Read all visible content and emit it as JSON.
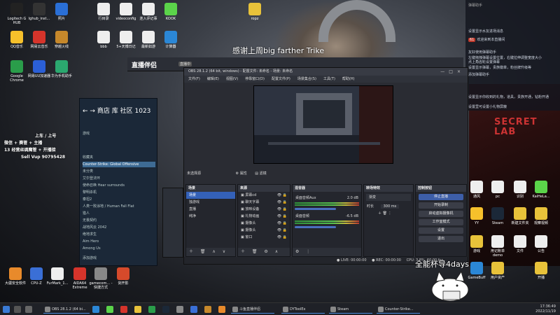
{
  "desktop": {
    "icons": [
      {
        "label": "Logitech G HUB",
        "color": "#222"
      },
      {
        "label": "lghub_inst...",
        "color": "#333"
      },
      {
        "label": "照片",
        "color": "#2a6fd6"
      },
      {
        "label": "QQ音乐",
        "color": "#f6c02b"
      },
      {
        "label": "网易云音乐",
        "color": "#d6342b"
      },
      {
        "label": "穿越火线",
        "color": "#c6882b"
      },
      {
        "label": "Google Chrome",
        "color": "#2a9d4a"
      },
      {
        "label": "网易UU加速器",
        "color": "#2b5fd6"
      },
      {
        "label": "华为手机助手",
        "color": "#2ba86f"
      },
      {
        "label": "行目录",
        "color": "#eee"
      },
      {
        "label": "videoconfig",
        "color": "#eee"
      },
      {
        "label": "连入评记事",
        "color": "#eee"
      },
      {
        "label": "KOOK",
        "color": "#5bd44a"
      },
      {
        "label": "bbb",
        "color": "#eee"
      },
      {
        "label": "5+天博日记",
        "color": "#eee"
      },
      {
        "label": "最新如游",
        "color": "#eee"
      },
      {
        "label": "计算器",
        "color": "#2b87d6"
      },
      {
        "label": "ropz",
        "color": "#e8c23a"
      }
    ],
    "bottom_icons": [
      {
        "label": "大疆安全软件",
        "color": "#e88a2b"
      },
      {
        "label": "CPU-Z",
        "color": "#3a6fd6"
      },
      {
        "label": "FurMark_1...",
        "color": "#eee"
      },
      {
        "label": "AIDA64 Extreme",
        "color": "#d6342b"
      },
      {
        "label": "gamecom... - 快捷方式",
        "color": "#888"
      },
      {
        "label": "剑开影",
        "color": "#d64a2b"
      }
    ],
    "right_icons": [
      {
        "label": "通风",
        "color": "#eee"
      },
      {
        "label": "pc",
        "color": "#eee"
      },
      {
        "label": "识别",
        "color": "#eee"
      },
      {
        "label": "KaiHeLa...",
        "color": "#5bd44a"
      },
      {
        "label": "YY",
        "color": "#f6c02b"
      },
      {
        "label": "Steam",
        "color": "#1b2838"
      },
      {
        "label": "新建文件夹",
        "color": "#e8c23a"
      },
      {
        "label": "观察视频",
        "color": "#e8c23a"
      },
      {
        "label": "游戏",
        "color": "#e8c23a"
      },
      {
        "label": "用记账单 demo",
        "color": "#eee"
      },
      {
        "label": "文件",
        "color": "#eee"
      },
      {
        "label": "公告",
        "color": "#eee"
      },
      {
        "label": "GameBuff",
        "color": "#2b87d6"
      },
      {
        "label": "用户资产",
        "color": "#e8c23a"
      },
      {
        "label": "开播",
        "color": "#e8c23a"
      }
    ]
  },
  "subtitle": "感谢上周big farther Trike",
  "watermark": "全能杯导4days",
  "chat": {
    "title": "弹幕助手",
    "lines": [
      "设置显示水友进场消息",
      "欢迎来到本直播间",
      "友好使用弹幕助手",
      "左键拖拽弹幕设置位置，右键拉伸调整宽度大小",
      "点上角齿轮设置弹幕",
      "设置显示弹幕，贵族徽章，粉丝牌升级等",
      "添加弹幕助手",
      "设置显示你收到的礼物，道具，贵族开通，钻粉开通",
      "设置里可设置小礼物屏蔽"
    ],
    "badge": "61"
  },
  "assistant": {
    "logo": "直播伴侣",
    "tag": "直播中"
  },
  "steam": {
    "nav_items": [
      "商店",
      "库",
      "社区",
      "1023"
    ],
    "filter": "游戏",
    "items": [
      {
        "label": "收藏夹",
        "active": false
      },
      {
        "label": "Counter-Strike: Global Offensive",
        "active": true
      },
      {
        "label": "未分类",
        "active": false
      },
      {
        "label": "艾尔登法环",
        "active": false
      },
      {
        "label": "使命召唤 Hear surrounds",
        "active": false
      },
      {
        "label": "黎明杀机",
        "active": false
      },
      {
        "label": "泰坦2",
        "active": false
      },
      {
        "label": "人类一败涂地 / Human Fall Flat",
        "active": false
      },
      {
        "label": "猎人",
        "active": false
      },
      {
        "label": "无畏契约",
        "active": false
      },
      {
        "label": "战地风云 2042",
        "active": false
      },
      {
        "label": "绝地求生",
        "active": false
      },
      {
        "label": "Aim Hero",
        "active": false
      },
      {
        "label": "Among Us",
        "active": false
      }
    ],
    "footer": "添加游戏"
  },
  "obs": {
    "title": "OBS 28.1.2 (64 bit, windows) - 配置文件: 未命名 - 场景: 未命名",
    "menu": [
      "文件(F)",
      "编辑(E)",
      "视图(V)",
      "停靠窗口(D)",
      "配置文件(P)",
      "场景集合(S)",
      "工具(T)",
      "帮助(H)"
    ],
    "scene_bar": {
      "label": "未选择源",
      "properties": "属性",
      "filters": "滤镜"
    },
    "scenes": {
      "title": "场景",
      "items": [
        {
          "label": "场景",
          "selected": true
        },
        {
          "label": "独游戏",
          "selected": false
        },
        {
          "label": "直播",
          "selected": false
        },
        {
          "label": "纯净",
          "selected": false
        }
      ]
    },
    "sources": {
      "title": "来源",
      "items": [
        "屏幕cd",
        "聊天字幕",
        "放映设备",
        "礼物动画",
        "摄像头",
        "摄像头",
        "窗口"
      ]
    },
    "mixer": {
      "title": "混音器",
      "channels": [
        {
          "label": "桌面音频Aux",
          "db": "2.0 dB"
        },
        {
          "label": "桌面音频",
          "db": "-6.5 dB"
        }
      ]
    },
    "transitions": {
      "title": "转场特效",
      "type": "渐变",
      "duration_label": "时长",
      "duration": "300 ms"
    },
    "controls": {
      "title": "控制按钮",
      "buttons": [
        {
          "label": "停止直播",
          "primary": true
        },
        {
          "label": "开始录制",
          "primary": false
        },
        {
          "label": "启动虚拟摄像机",
          "primary": false
        },
        {
          "label": "工作室模式",
          "primary": false
        },
        {
          "label": "设置",
          "primary": false
        },
        {
          "label": "退出",
          "primary": false
        }
      ]
    },
    "status": {
      "live": "LIVE: 00:00:00",
      "rec": "REC: 00:00:00",
      "cpu": "CPU: 3.8%, 60.00 fps"
    }
  },
  "floater": {
    "lines": [
      "上车 / 上号",
      "微信 + 赛管 + 主播",
      "13 经营丝绸魔管 + 开播接",
      "Sell Vup 90795428"
    ]
  },
  "taskbar": {
    "apps": [
      "OBS 28.1.2 (64 bi...",
      "斗鱼直播伴侣",
      "DYToolEx",
      "Steam",
      "Counter-Strike..."
    ],
    "time": "17:36:49",
    "date": "2022/11/19"
  },
  "colors": {
    "accent": "#3461b8",
    "steam_bg": "#1b2838",
    "obs_bg": "#2a2c33"
  }
}
